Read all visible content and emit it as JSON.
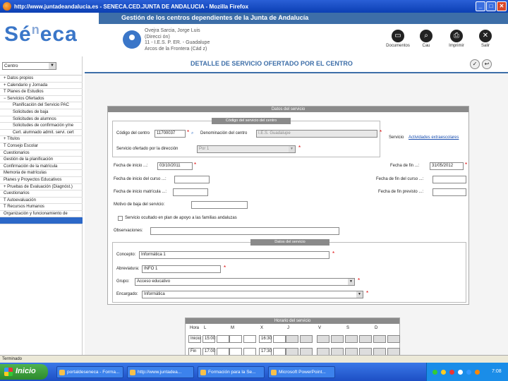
{
  "browser": {
    "title": "http://www.juntadeandalucia.es - SENECA.CED.JUNTA DE ANDALUCIA - Mozilla Firefox"
  },
  "header": {
    "logo": "Séneca",
    "band_title": "Gestión de los centros dependientes de la Junta de Andalucía",
    "user": {
      "name": "Ovejra Sarcia, Jorge Luis",
      "role": "(Direcci ón)",
      "center": "11 - I.E.S. P. ER. - Guadalupe",
      "city": "Arcos de la Frontera (Cád z)"
    },
    "buttons": [
      {
        "label": "Documentos",
        "icon": "documents-icon"
      },
      {
        "label": "Cau",
        "icon": "cau-icon"
      },
      {
        "label": "Imprimir",
        "icon": "print-icon"
      },
      {
        "label": "Salir",
        "icon": "exit-icon"
      }
    ]
  },
  "sidebar": {
    "context_select": "Centro",
    "menu": [
      "+ Datos propios",
      "+ Calendario y Jornada",
      "T Planes de Estudios",
      "− Servicios Ofertados",
      "Planificación del Servicio PAC",
      "Solicitudes de baja",
      "Solicitudes de alumnos",
      "Solicitudes de confirmación y/ne",
      "Cert. alumnado admit. servi. cert",
      "+ Títulos",
      "T Consejo Escolar",
      "Cuestionarios",
      "Gestión de la planificación",
      "Confirmación de la matrícula",
      "Memoria de matrículas",
      "Planes y Proyectos Educativos",
      "+ Pruebas de Evaluación (Diagnóst.)",
      "Cuestionarios",
      "T Autoevaluación",
      "T Recursos Humanos",
      "Organización y funcionamiento de",
      ""
    ]
  },
  "page": {
    "title": "DETALLE DE SERVICIO OFERTADO POR EL CENTRO",
    "panel_title": "Datos del servicio",
    "section1_title": "Código del servicio del centro",
    "section2_title": "Datos del servicio",
    "schedule_title": "Horario del servicio",
    "labels": {
      "codigo_centro": "Código del centro",
      "denominacion": "Denominación del centro",
      "servicio": "Servicio",
      "servicio_tipo": "Servicio ofertado por la dirección",
      "fecha_inicio": "Fecha de inicio ...:",
      "fecha_fin": "Fecha de fin ...:",
      "fecha_inicio_del_curso": "Fecha de inicio del curso ...:",
      "fecha_fin_del_curso": "Fecha de fin del curso ...:",
      "fecha_inicio_matricula": "Fecha de inicio matrícula ...:",
      "fecha_fin_previsto": "Fecha de fin previsto ...:",
      "motivo_baja": "Motivo de baja del servicio:",
      "checkbox": "Servicio ocultado en plan de apoyo a las familias andaluzas",
      "observaciones": "Observaciones:",
      "concepto": "Concepto:",
      "abreviatura": "Abreviatura:",
      "grupo": "Grupo:",
      "encargado": "Encargado:"
    },
    "values": {
      "codigo_centro": "11700037",
      "denominacion": "I.E.S. Guadalupe",
      "servicio_link": "Actividades extraescolares",
      "servicio_tipo": "Por 1",
      "fecha_inicio": "03/10/2011",
      "fecha_fin": "31/05/2012",
      "concepto": "Informática 1",
      "abreviatura": "INFO 1",
      "grupo": "Acceso educativo",
      "encargado": "Informática"
    },
    "schedule": {
      "headers": [
        "Hora",
        "L",
        "M",
        "X",
        "J",
        "V",
        "S",
        "D"
      ],
      "rows": [
        {
          "day": "Inicio",
          "values": [
            "15:00",
            "",
            "16:30",
            "",
            "",
            "",
            ""
          ]
        },
        {
          "day": "Fin",
          "values": [
            "17:00",
            "",
            "17:30",
            "",
            "",
            "",
            ""
          ]
        }
      ]
    }
  },
  "statusbar": {
    "text": "Terminado"
  },
  "taskbar": {
    "start": "Inicio",
    "tasks": [
      "portaldeseneca - Forma...",
      "http://www.juntadea...",
      "Formación para la Se...",
      "Microsoft PowerPoint..."
    ],
    "clock": "7:08"
  }
}
